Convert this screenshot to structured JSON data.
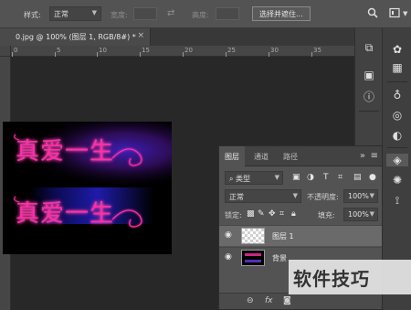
{
  "options_bar": {
    "style_label": "样式:",
    "style_value": "正常",
    "width_label": "宽度:",
    "height_label": "高度:",
    "select_mask_button": "选择并遮住..."
  },
  "document_tab": {
    "title": "0.jpg @ 100% (图层 1, RGB/8#) *",
    "close": "×"
  },
  "ruler": {
    "ticks": [
      "0",
      "5",
      "10",
      "15",
      "20",
      "25",
      "30",
      "35"
    ]
  },
  "canvas": {
    "text_top": "真爱一生",
    "text_bottom": "真爱一生"
  },
  "layers_panel": {
    "tabs": [
      "图层",
      "通道",
      "路径"
    ],
    "filter_kind": "类型",
    "blend_mode": "正常",
    "opacity_label": "不透明度:",
    "opacity_value": "100%",
    "lock_label": "锁定:",
    "fill_label": "填充:",
    "fill_value": "100%",
    "layers": [
      {
        "name": "图层 1",
        "selected": true
      },
      {
        "name": "背景",
        "selected": false
      }
    ],
    "footer_fx": "fx"
  },
  "watermark": "软件技巧",
  "colors": {
    "neon_pink": "#ff2fa8",
    "glow_blue": "#2a22c8",
    "glow_purple": "#5a1a8c"
  }
}
